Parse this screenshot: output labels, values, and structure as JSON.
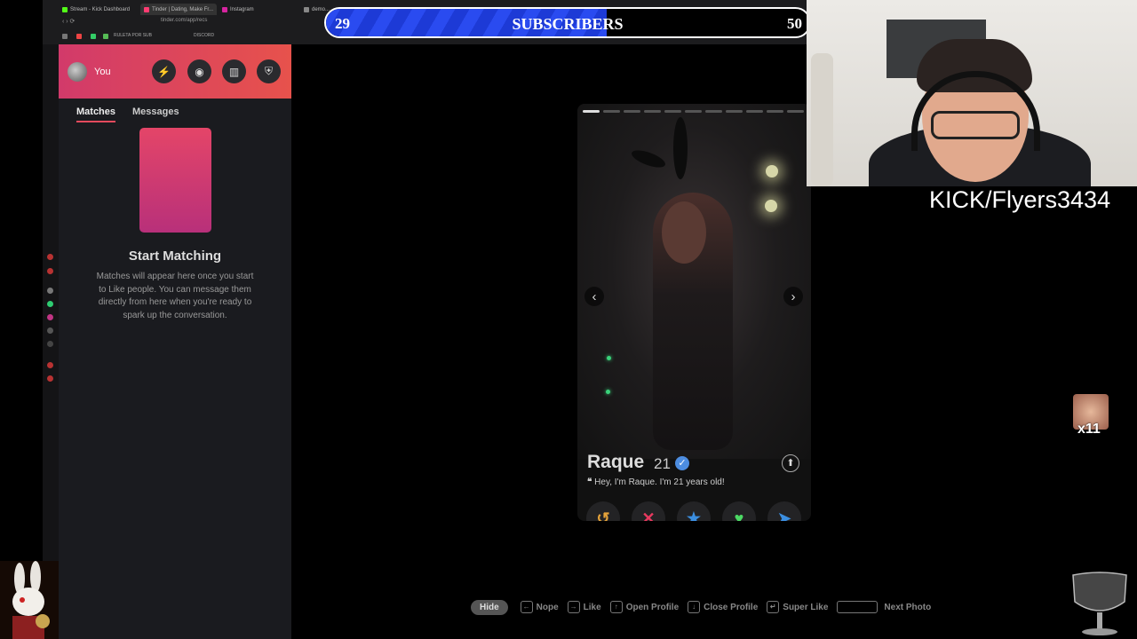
{
  "browser": {
    "tabs": [
      {
        "label": "Stream - Kick Dashboard",
        "color": "#53fc18"
      },
      {
        "label": "Tinder | Dating, Make Fr...",
        "color": "#fe3c72"
      },
      {
        "label": "Instagram",
        "color": "#d6249f"
      },
      {
        "label": "demo...",
        "color": "#888888"
      }
    ],
    "url": "tinder.com/app/recs",
    "bookmarks": [
      "RULETA POR SUB",
      "DISCORD"
    ]
  },
  "sidebar": {
    "user_label": "You",
    "header_buttons": [
      "boost-icon",
      "explore-icon",
      "work-icon",
      "shield-icon"
    ],
    "tabs": [
      "Matches",
      "Messages"
    ],
    "empty_title": "Start Matching",
    "empty_description": "Matches will appear here once you start to Like people. You can message them directly from here when you're ready to spark up the conversation."
  },
  "subscriber_goal": {
    "current": "29",
    "title": "SUBSCRIBERS",
    "goal": "50",
    "progress": 0.58,
    "color": "#2a4bf0"
  },
  "profile": {
    "name": "Raque",
    "age": "21",
    "bio": "Hey, I'm Raque. I'm 21 years old!",
    "photo_count": 11,
    "current_photo": 1
  },
  "actions": [
    {
      "name": "rewind",
      "glyph": "↺",
      "color": "#e5a33a"
    },
    {
      "name": "nope",
      "glyph": "✕",
      "color": "#e8395f"
    },
    {
      "name": "super-like",
      "glyph": "★",
      "color": "#3b8ee0"
    },
    {
      "name": "like",
      "glyph": "♥",
      "color": "#4cd964"
    },
    {
      "name": "boost",
      "glyph": "➤",
      "color": "#3b8ee0"
    }
  ],
  "stream": {
    "handle": "KICK/Flyers3434",
    "emote_count": "x11"
  },
  "hints": {
    "hide": "Hide",
    "items": [
      {
        "key": "←",
        "label": "Nope"
      },
      {
        "key": "→",
        "label": "Like"
      },
      {
        "key": "↑",
        "label": "Open Profile"
      },
      {
        "key": "↓",
        "label": "Close Profile"
      },
      {
        "key": "↵",
        "label": "Super Like"
      },
      {
        "key": "",
        "label": "Next Photo"
      }
    ]
  }
}
